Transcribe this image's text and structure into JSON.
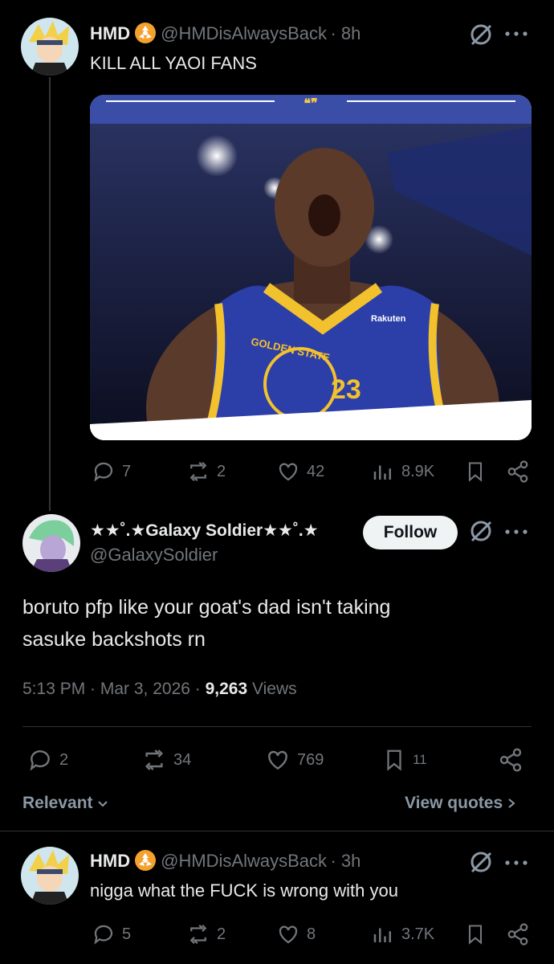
{
  "tweet1": {
    "name": "HMD",
    "handle": "@HMDisAlwaysBack",
    "time": "· 8h",
    "text": "KILL ALL YAOI FANS",
    "media": {
      "quote_mark": "❝❞",
      "jersey_sponsor": "Rakuten",
      "jersey_team": "GOLDEN STATE",
      "jersey_number": "23"
    },
    "actions": {
      "replies": "7",
      "reposts": "2",
      "likes": "42",
      "views": "8.9K"
    }
  },
  "tweet2": {
    "name": "★★˚.★Galaxy Soldier★★˚.★",
    "handle": "@GalaxySoldier",
    "follow_label": "Follow",
    "text_line1": "boruto pfp like your goat's dad isn't taking",
    "text_line2": "sasuke backshots rn",
    "timestamp": "5:13 PM · Mar 3, 2026 ·",
    "views_count": "9,263",
    "views_label": "Views",
    "actions": {
      "replies": "2",
      "reposts": "34",
      "likes": "769",
      "bookmarks": "11"
    },
    "relevant_label": "Relevant",
    "view_quotes_label": "View quotes"
  },
  "tweet3": {
    "name": "HMD",
    "handle": "@HMDisAlwaysBack",
    "time": "· 3h",
    "text": "nigga what the FUCK is wrong with you",
    "actions": {
      "replies": "5",
      "reposts": "2",
      "likes": "8",
      "views": "3.7K"
    }
  },
  "colors": {
    "background": "#000000",
    "text": "#e7e9ea",
    "muted": "#71767b",
    "badge": "#f4a22d",
    "divider": "#2f3336"
  }
}
